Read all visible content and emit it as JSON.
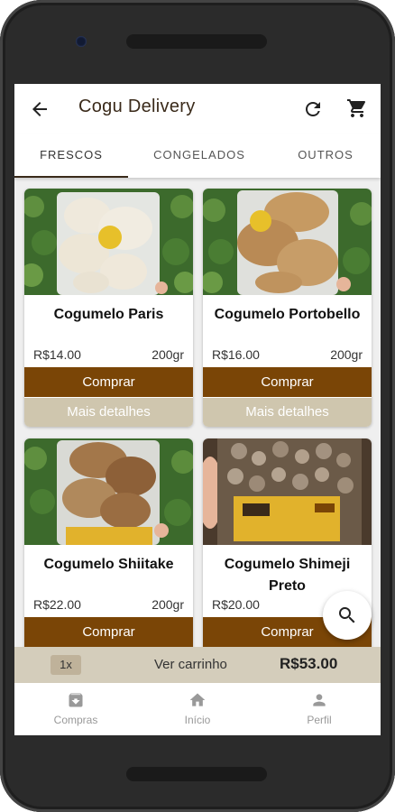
{
  "app": {
    "title": "Cogu Delivery"
  },
  "tabs": [
    {
      "label": "FRESCOS",
      "selected": true
    },
    {
      "label": "CONGELADOS",
      "selected": false
    },
    {
      "label": "OUTROS",
      "selected": false
    }
  ],
  "products": [
    {
      "name": "Cogumelo Paris",
      "price": "R$14.00",
      "weight": "200gr",
      "buy_label": "Comprar",
      "details_label": "Mais detalhes"
    },
    {
      "name": "Cogumelo Portobello",
      "price": "R$16.00",
      "weight": "200gr",
      "buy_label": "Comprar",
      "details_label": "Mais detalhes"
    },
    {
      "name": "Cogumelo Shiitake",
      "price": "R$22.00",
      "weight": "200gr",
      "buy_label": "Comprar"
    },
    {
      "name": "Cogumelo Shimeji Preto",
      "price": "R$20.00",
      "buy_label": "Comprar"
    }
  ],
  "cart": {
    "quantity": "1x",
    "view_label": "Ver carrinho",
    "total": "R$53.00"
  },
  "bottom_nav": [
    {
      "label": "Compras",
      "icon": "archive-box-icon"
    },
    {
      "label": "Início",
      "icon": "home-icon"
    },
    {
      "label": "Perfil",
      "icon": "person-icon"
    }
  ],
  "colors": {
    "accent": "#7a4506",
    "secondary": "#cfc6ae",
    "cart_bar": "#d4cdbb"
  }
}
